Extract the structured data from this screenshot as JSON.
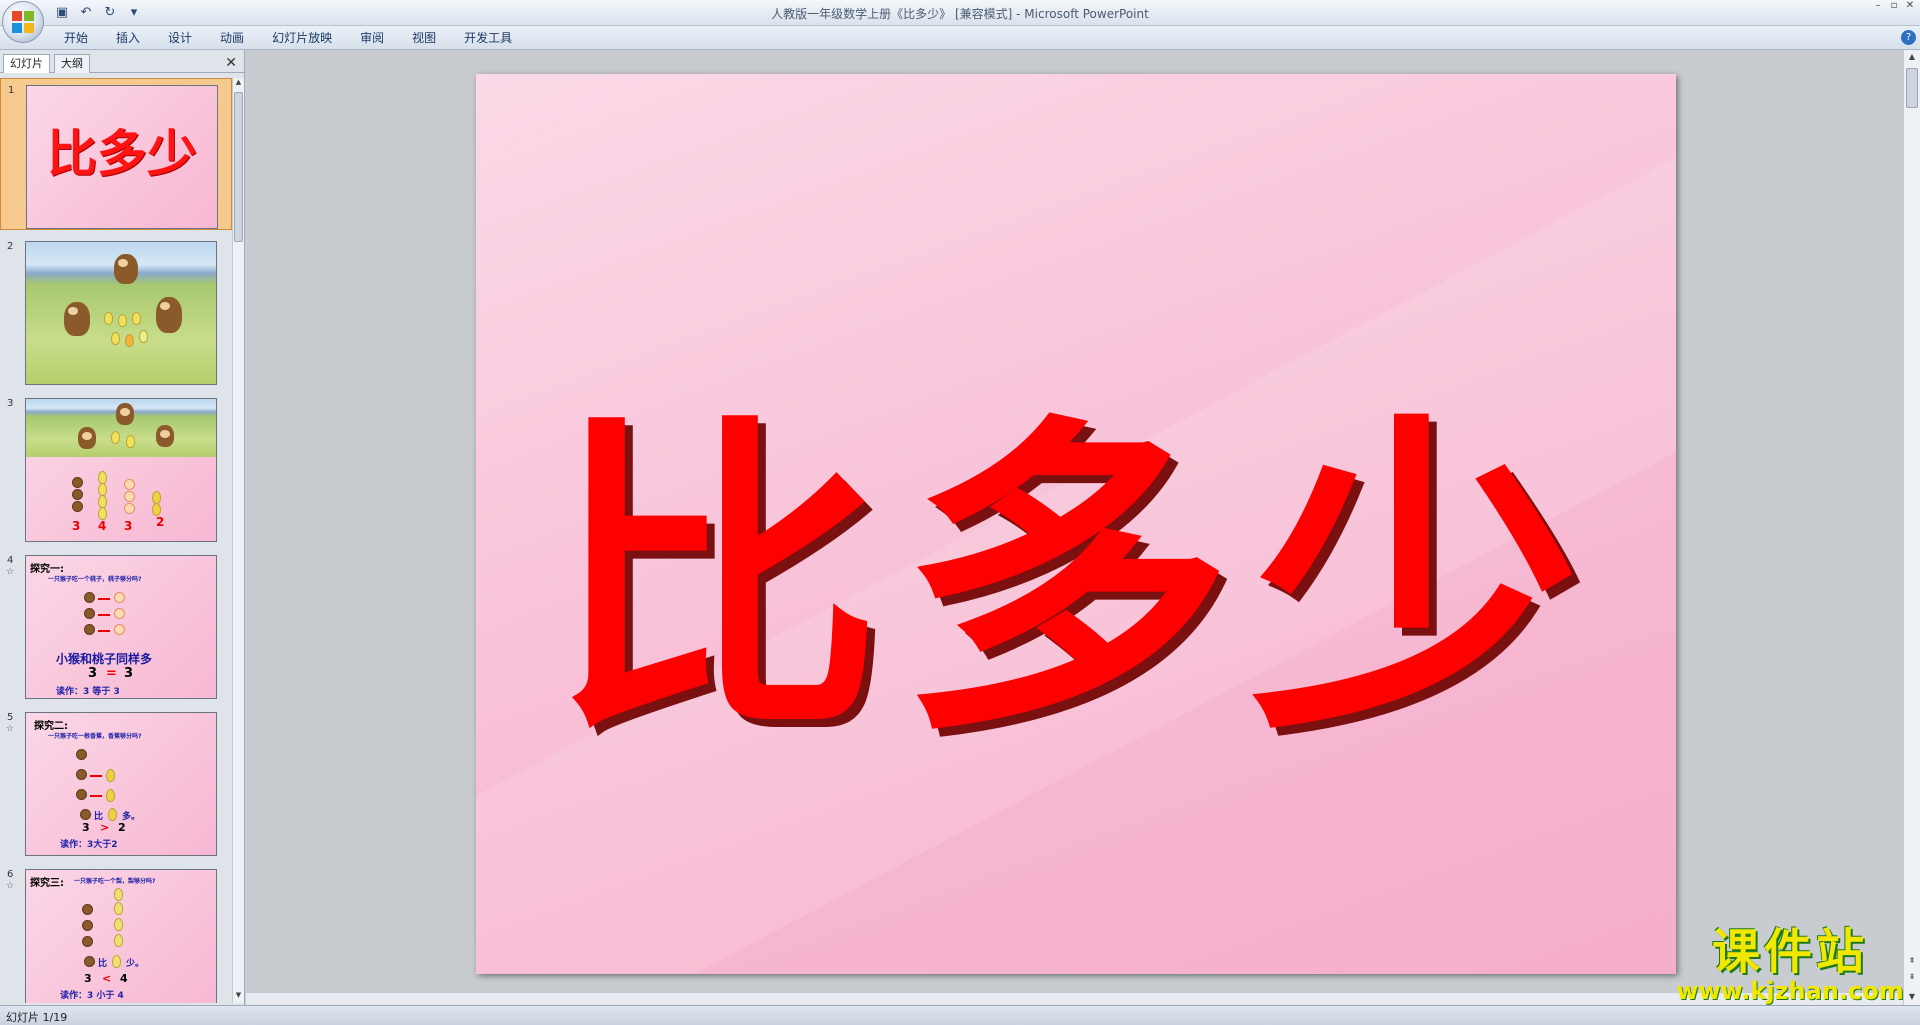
{
  "app": {
    "title": "人教版一年级数学上册《比多少》 [兼容模式] - Microsoft PowerPoint",
    "quick_access": [
      "save-icon",
      "undo-icon",
      "redo-icon",
      "customize-icon"
    ],
    "window_controls": [
      "–",
      "▫",
      "✕"
    ]
  },
  "ribbon": {
    "tabs": [
      "开始",
      "插入",
      "设计",
      "动画",
      "幻灯片放映",
      "审阅",
      "视图",
      "开发工具"
    ],
    "help": "?"
  },
  "left_panel": {
    "tabs": [
      "幻灯片",
      "大纲"
    ],
    "close": "✕",
    "slides": [
      {
        "num": "1",
        "title": "比多少"
      },
      {
        "num": "2"
      },
      {
        "num": "3",
        "counts": [
          "3",
          "4",
          "3",
          "2"
        ]
      },
      {
        "num": "4",
        "heading": "探究一:",
        "question": "一只猴子吃一个桃子，桃子够分吗?",
        "statement": "小猴和桃子同样多",
        "eq_left": "3",
        "eq_op": "=",
        "eq_right": "3",
        "reading": "读作：3 等于 3"
      },
      {
        "num": "5",
        "heading": "探究二:",
        "question": "一只猴子吃一根香蕉，香蕉够分吗?",
        "compare_a": "比",
        "compare_b": "多。",
        "eq_left": "3",
        "eq_op": ">",
        "eq_right": "2",
        "reading": "读作：3大于2"
      },
      {
        "num": "6",
        "heading": "探究三:",
        "question": "一只猴子吃一个梨，梨够分吗?",
        "compare_a": "比",
        "compare_b": "少。",
        "eq_left": "3",
        "eq_op": "<",
        "eq_right": "4",
        "reading": "读作：3 小于 4"
      }
    ]
  },
  "main_slide": {
    "title": "比多少"
  },
  "status": {
    "text": "幻灯片 1/19"
  },
  "watermark": {
    "brand": "课件站",
    "url": "www.kjzhan.com"
  },
  "colors": {
    "title_red": "#ff0000",
    "slide_pink": "#f9c8dc",
    "selected_slide": "#f6c98e",
    "watermark_yellow": "#f2e700"
  }
}
